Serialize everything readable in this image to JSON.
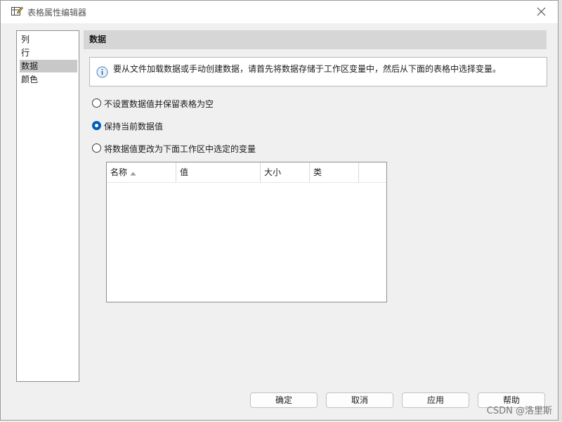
{
  "window": {
    "title": "表格属性编辑器"
  },
  "nav": {
    "items": [
      {
        "label": "列",
        "selected": false
      },
      {
        "label": "行",
        "selected": false
      },
      {
        "label": "数据",
        "selected": true
      },
      {
        "label": "颜色",
        "selected": false
      }
    ]
  },
  "section": {
    "title": "数据"
  },
  "info": {
    "text": "要从文件加载数据或手动创建数据，请首先将数据存储于工作区变量中，然后从下面的表格中选择变量。"
  },
  "options": [
    {
      "label": "不设置数据值并保留表格为空",
      "checked": false
    },
    {
      "label": "保持当前数据值",
      "checked": true
    },
    {
      "label": "将数据值更改为下面工作区中选定的变量",
      "checked": false
    }
  ],
  "table": {
    "columns": [
      "名称",
      "值",
      "大小",
      "类"
    ],
    "sort_column": "名称",
    "sort_direction": "ascending",
    "rows": []
  },
  "buttons": {
    "ok": "确定",
    "cancel": "取消",
    "apply": "应用",
    "help": "帮助"
  },
  "watermark": "CSDN @洛里斯",
  "colors": {
    "accent": "#005fb8",
    "selection": "#c8c8c8",
    "header": "#d6d6d6"
  }
}
